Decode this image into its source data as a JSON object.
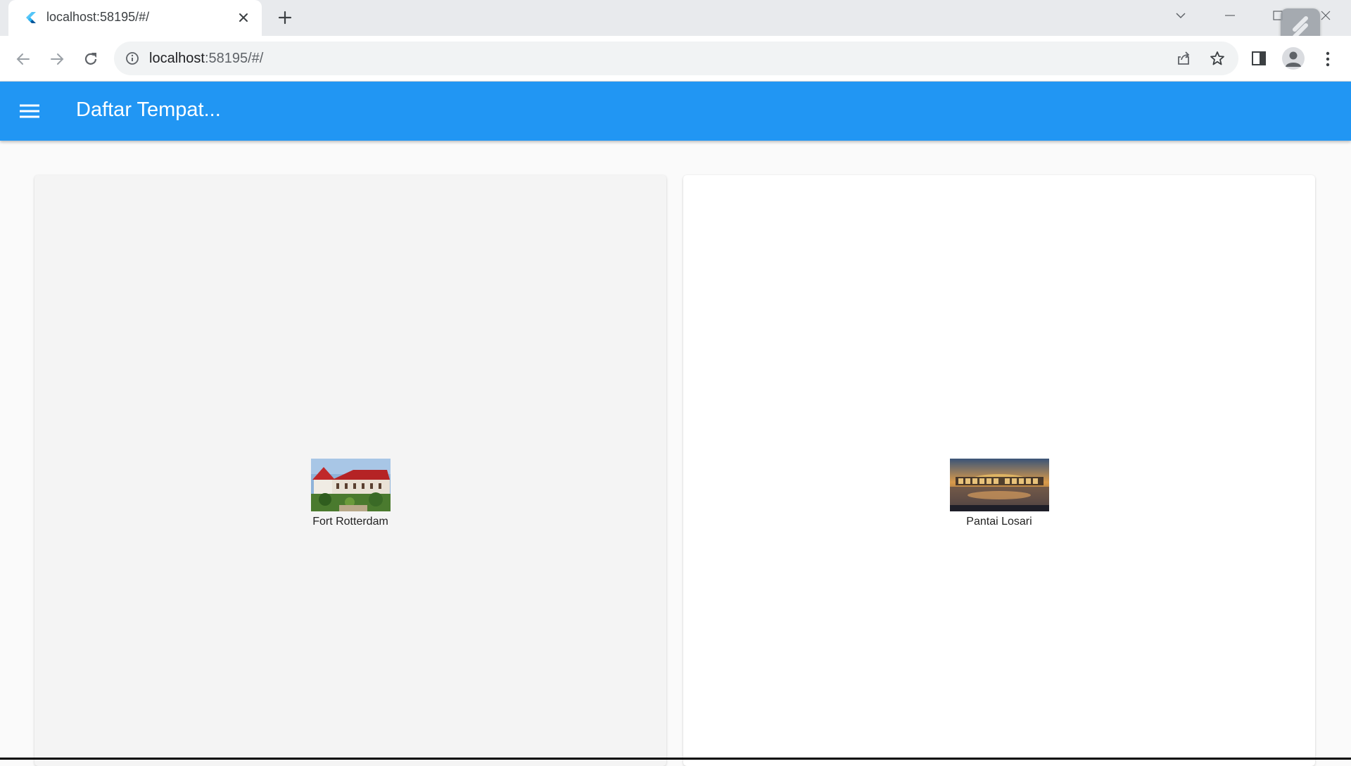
{
  "browser": {
    "tab_title": "localhost:58195/#/",
    "url_host": "localhost",
    "url_rest": ":58195/#/"
  },
  "app": {
    "title": "Daftar Tempat...",
    "colors": {
      "appbar": "#2196f3",
      "background": "#fafafa"
    }
  },
  "places": [
    {
      "name": "Fort Rotterdam"
    },
    {
      "name": "Pantai Losari"
    }
  ]
}
